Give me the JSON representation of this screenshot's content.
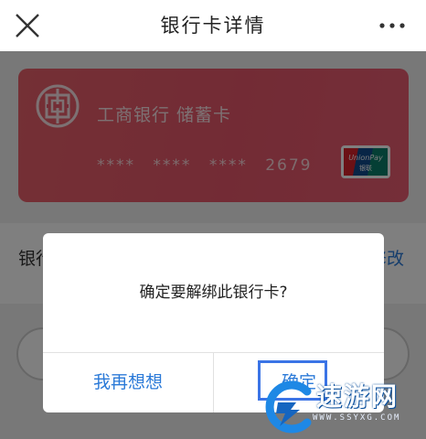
{
  "header": {
    "title": "银行卡详情"
  },
  "card": {
    "bank_name": "工商银行  储蓄卡",
    "masks": [
      "****",
      "****",
      "****"
    ],
    "last4": "2679",
    "network": "UnionPay 银联",
    "color": "#e65b6c"
  },
  "row": {
    "label": "银行",
    "action": "修改"
  },
  "dialog": {
    "message": "确定要解绑此银行卡?",
    "cancel_label": "我再想想",
    "confirm_label": "确定"
  },
  "watermark": {
    "text": "速游网",
    "url": "WWW.SSYXG.COM"
  },
  "colors": {
    "accent": "#2b7ad8",
    "highlight": "#3b74e6"
  }
}
